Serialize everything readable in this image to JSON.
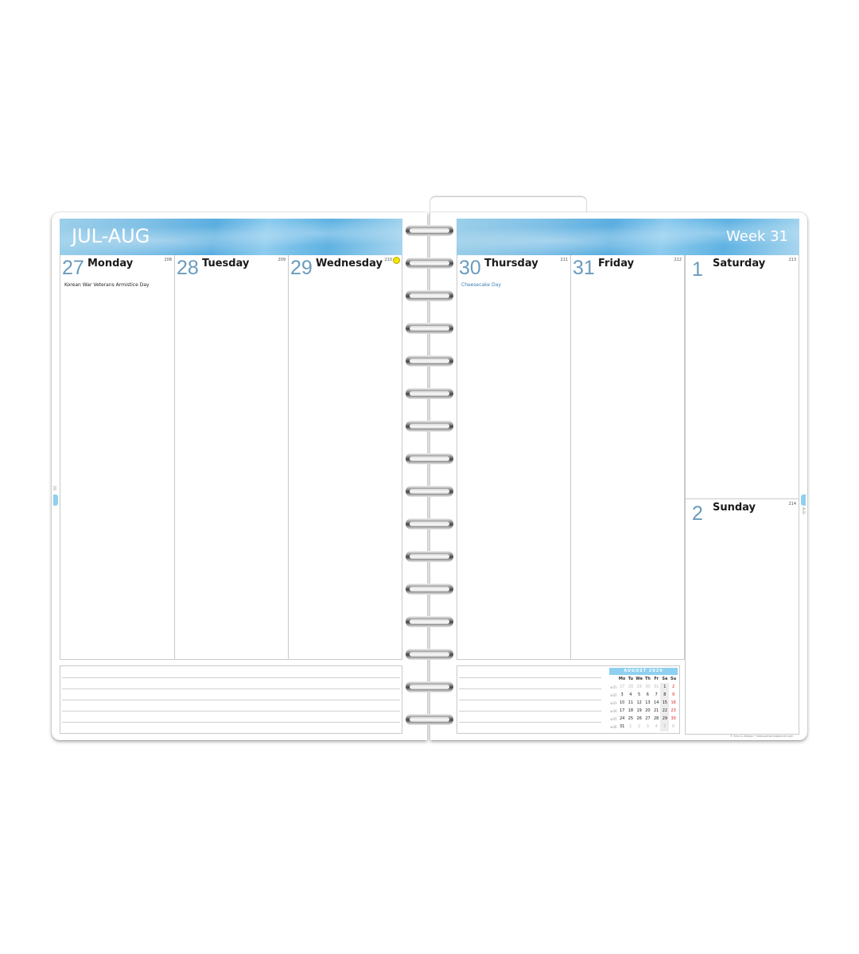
{
  "header": {
    "month": "JUL-AUG",
    "week": "Week 31"
  },
  "days": [
    {
      "num": "27",
      "name": "Monday",
      "doy": "208",
      "event": "Korean War Veterans Armistice Day"
    },
    {
      "num": "28",
      "name": "Tuesday",
      "doy": "209",
      "event": ""
    },
    {
      "num": "29",
      "name": "Wednesday",
      "doy": "210",
      "event": ""
    },
    {
      "num": "30",
      "name": "Thursday",
      "doy": "211",
      "event": "Cheesecake Day"
    },
    {
      "num": "31",
      "name": "Friday",
      "doy": "212",
      "event": ""
    },
    {
      "num": "1",
      "name": "Saturday",
      "doy": "213",
      "event": ""
    },
    {
      "num": "2",
      "name": "Sunday",
      "doy": "214",
      "event": ""
    }
  ],
  "mini_calendar": {
    "title": "AUGUST 2026",
    "headers": [
      "Mo",
      "Tu",
      "We",
      "Th",
      "Fr",
      "Sa",
      "Su"
    ],
    "weeks": [
      {
        "wk": "w31",
        "days": [
          "27",
          "28",
          "29",
          "30",
          "31",
          "1",
          "2"
        ]
      },
      {
        "wk": "w32",
        "days": [
          "3",
          "4",
          "5",
          "6",
          "7",
          "8",
          "9"
        ]
      },
      {
        "wk": "w33",
        "days": [
          "10",
          "11",
          "12",
          "13",
          "14",
          "15",
          "16"
        ]
      },
      {
        "wk": "w34",
        "days": [
          "17",
          "18",
          "19",
          "20",
          "21",
          "22",
          "23"
        ]
      },
      {
        "wk": "w35",
        "days": [
          "24",
          "25",
          "26",
          "27",
          "28",
          "29",
          "30"
        ]
      },
      {
        "wk": "w36",
        "days": [
          "31",
          "1",
          "2",
          "3",
          "4",
          "5",
          "6"
        ]
      }
    ]
  },
  "side_labels": {
    "left": "JUL",
    "right": "AUG"
  },
  "footer": {
    "copyright": "© Kins & Design • www.personalplanner.com"
  },
  "colors": {
    "accent": "#6a9bbe",
    "header": "#7fc0e6",
    "moon": "#f2e600"
  }
}
